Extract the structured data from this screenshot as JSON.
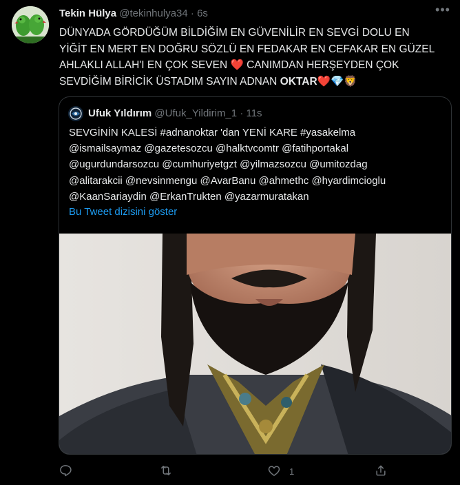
{
  "tweet": {
    "author_name": "Tekin Hülya",
    "author_handle": "@tekinhulya34",
    "separator": "·",
    "time": "6s",
    "lines": [
      "DÜNYADA GÖRDÜĞÜM BİLDİĞİM EN GÜVENİLİR EN SEVGİ DOLU EN",
      "YİĞİT EN MERT EN DOĞRU SÖZLÜ EN FEDAKAR EN CEFAKAR EN GÜZEL",
      "AHLAKLI ALLAH'I EN ÇOK SEVEN",
      "CANIMDAN HERŞEYDEN ÇOK",
      "SEVDİĞİM BİRİCİK ÜSTADIM SAYIN ADNAN",
      "OKTAR"
    ],
    "emoji_heart": "❤️",
    "emoji_gem": "💎",
    "emoji_lion": "🦁",
    "accent_heart_color": "#f4212e"
  },
  "quote": {
    "author_name": "Ufuk Yıldırım",
    "author_handle": "@Ufuk_Yildirim_1",
    "separator": "·",
    "time": "11s",
    "lines": [
      "SEVGİNİN KALESİ #adnanoktar 'dan YENİ KARE #yasakelma",
      "@ismailsaymaz @gazetesozcu @halktvcomtr @fatihportakal",
      "@ugurdundarsozcu @cumhuriyetgzt @yilmazsozcu @umitozdag",
      "@alitarakcii @nevsinmengu  @AvarBanu @ahmethc @hyardimcioglu",
      "@KaanSariaydin @ErkanTrukten @yazarmuratakan"
    ],
    "show_thread": "Bu Tweet dizisini göster",
    "link_color": "#1d9bf0"
  },
  "actions": {
    "reply_icon": "reply-icon",
    "retweet_icon": "retweet-icon",
    "like_icon": "like-icon",
    "like_count": "1",
    "share_icon": "share-icon"
  },
  "theme": {
    "background": "#000000",
    "text": "#e7e9ea",
    "muted": "#71767b",
    "border": "#2f3336"
  }
}
